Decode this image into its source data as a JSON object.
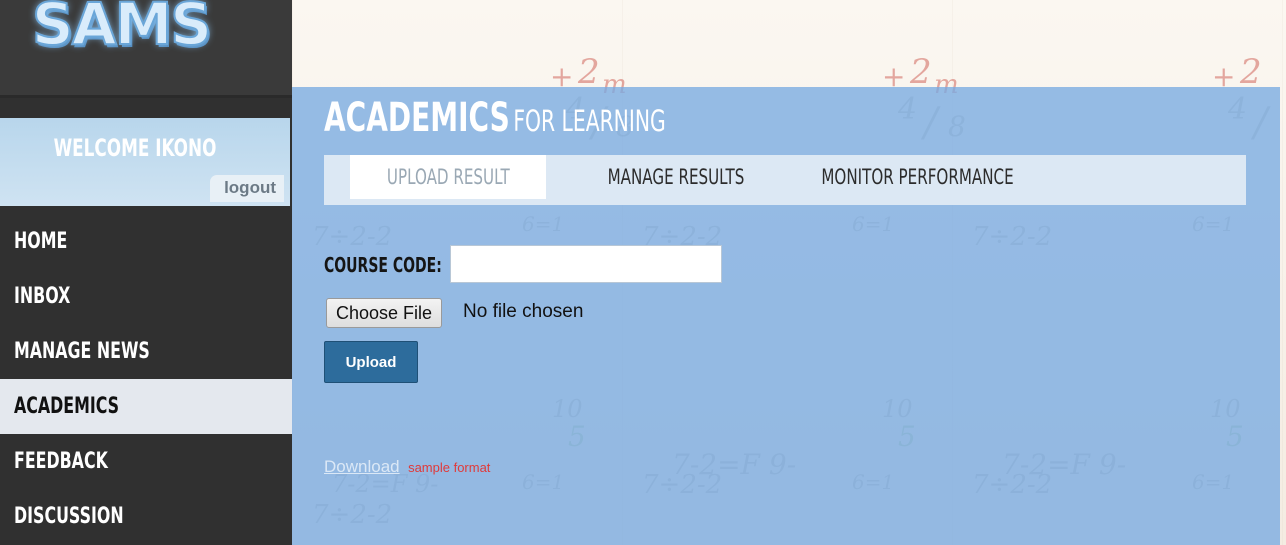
{
  "brand": {
    "logo_text": "SAMS"
  },
  "user_box": {
    "welcome": "WELCOME IKONO",
    "logout": "logout"
  },
  "nav": {
    "items": [
      {
        "label": "HOME",
        "active": false
      },
      {
        "label": "INBOX",
        "active": false
      },
      {
        "label": "MANAGE NEWS",
        "active": false
      },
      {
        "label": "ACADEMICS",
        "active": true
      },
      {
        "label": "FEEDBACK",
        "active": false
      },
      {
        "label": "DISCUSSION",
        "active": false
      }
    ]
  },
  "page": {
    "title_main": "ACADEMICS",
    "title_sub": "FOR LEARNING"
  },
  "tabs": [
    {
      "label": "UPLOAD RESULT",
      "active": true
    },
    {
      "label": "MANAGE RESULTS",
      "active": false
    },
    {
      "label": "MONITOR PERFORMANCE",
      "active": false
    }
  ],
  "form": {
    "course_code_label": "COURSE CODE:",
    "course_code_value": "",
    "choose_file_label": "Choose File",
    "file_status": "No file chosen",
    "upload_label": "Upload"
  },
  "download": {
    "link_text": "Download",
    "note": "sample format"
  },
  "colors": {
    "sidebar": "#303030",
    "panel": "#78aae1",
    "upload_button": "#2d6c9c",
    "note_red": "#e03a3a"
  }
}
